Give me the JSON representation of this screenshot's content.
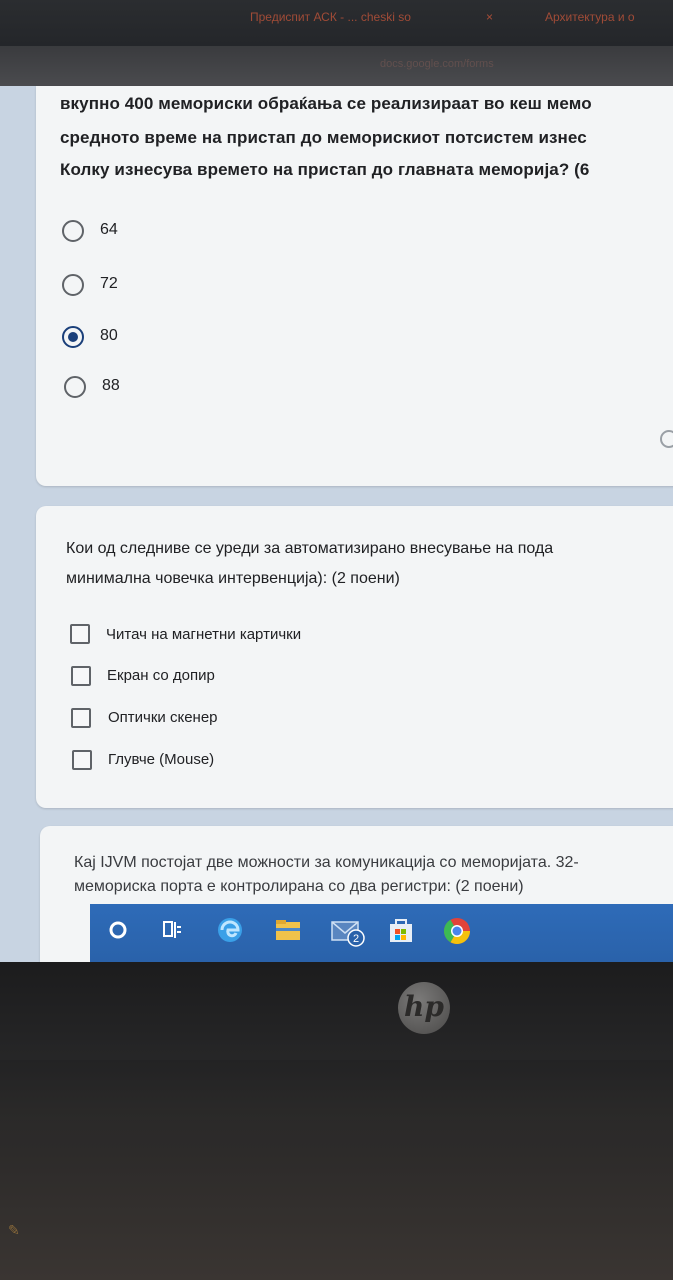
{
  "browser": {
    "tabs": [
      {
        "label": "Предиспит АСК - ... cheski so",
        "close": "×"
      },
      {
        "label": "Архитектура и о",
        "close": "×"
      }
    ],
    "url": "docs.google.com/forms"
  },
  "question1": {
    "lines": [
      "вкупно 400 мемориски обраќања се реализираат во кеш мемо",
      "средното време на пристап до меморискиот потсистем изнес",
      "Колку изнесува времето на пристап до главната меморија? (6"
    ],
    "options": [
      {
        "label": "64",
        "selected": false
      },
      {
        "label": "72",
        "selected": false
      },
      {
        "label": "80",
        "selected": true
      },
      {
        "label": "88",
        "selected": false
      }
    ]
  },
  "question2": {
    "lines": [
      "Кои од следниве се уреди за автоматизирано внесување на пода",
      "минимална човечка интервенција): (2 поени)"
    ],
    "options": [
      {
        "label": "Читач на магнетни картички",
        "checked": false
      },
      {
        "label": "Екран со допир",
        "checked": false
      },
      {
        "label": "Оптички скенер",
        "checked": false
      },
      {
        "label": "Глувче (Mouse)",
        "checked": false
      }
    ]
  },
  "question3": {
    "lines": [
      "Кај IJVM постојат две можности за комуникација со меморијата. 32-",
      "мемориска порта е контролирана со два регистри: (2 поени)"
    ]
  },
  "taskbar": {
    "icons": [
      "search-circle-icon",
      "task-view-icon",
      "edge-icon",
      "file-explorer-icon",
      "mail-icon",
      "store-icon",
      "chrome-icon"
    ],
    "mail_badge": "2",
    "color": "#2e6bb8"
  },
  "laptop": {
    "brand": "hp"
  }
}
